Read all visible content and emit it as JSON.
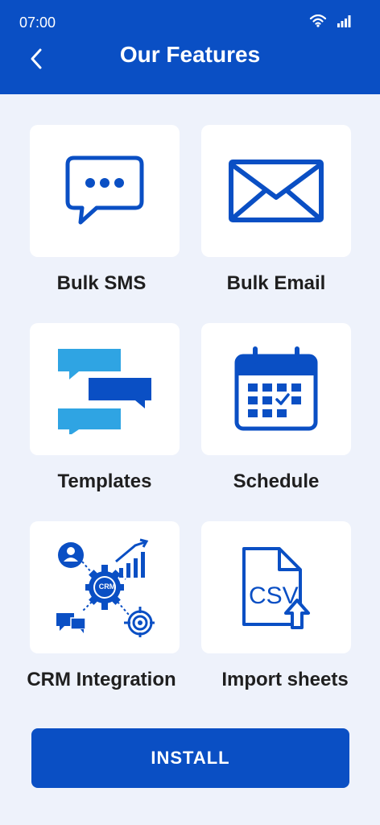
{
  "status": {
    "time": "07:00"
  },
  "header": {
    "title": "Our Features"
  },
  "features": [
    {
      "label": "Bulk SMS",
      "icon": "chat-bubble-icon"
    },
    {
      "label": "Bulk Email",
      "icon": "envelope-icon"
    },
    {
      "label": "Templates",
      "icon": "template-bubbles-icon"
    },
    {
      "label": "Schedule",
      "icon": "calendar-icon"
    },
    {
      "label": "CRM Integration",
      "icon": "crm-gear-icon"
    },
    {
      "label": "Import sheets",
      "icon": "csv-file-upload-icon"
    }
  ],
  "install": {
    "label": "INSTALL"
  },
  "colors": {
    "primary": "#0A4FC4",
    "light_blue": "#2FA4E3",
    "background": "#EEF2FB"
  }
}
